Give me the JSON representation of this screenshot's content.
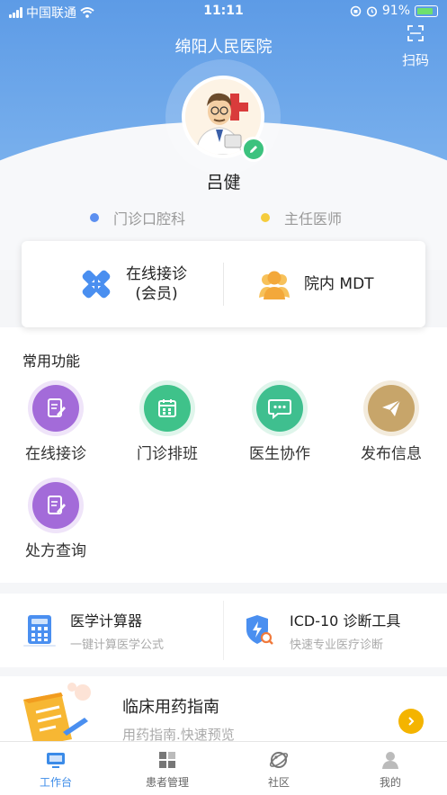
{
  "status_bar": {
    "carrier": "中国联通",
    "time": "11:11",
    "battery": "91%"
  },
  "header": {
    "title": "绵阳人民医院",
    "scan_label": "扫码"
  },
  "profile": {
    "name": "吕健",
    "department": "门诊口腔科",
    "title": "主任医师",
    "department_dot_color": "#5b8ff0",
    "title_dot_color": "#f5cc3c"
  },
  "main_card": {
    "consult_line1": "在线接诊",
    "consult_line2": "(会员)",
    "mdt_label": "院内 MDT"
  },
  "functions": {
    "title": "常用功能",
    "items": [
      {
        "label": "在线接诊",
        "icon": "clipboard-pen-icon",
        "color": "#a36bd9"
      },
      {
        "label": "门诊排班",
        "icon": "calendar-icon",
        "color": "#3fc28a"
      },
      {
        "label": "医生协作",
        "icon": "chat-icon",
        "color": "#3fbf8f"
      },
      {
        "label": "发布信息",
        "icon": "paper-plane-icon",
        "color": "#c7a56a"
      },
      {
        "label": "处方查询",
        "icon": "prescription-icon",
        "color": "#a36bd9"
      }
    ]
  },
  "tools": {
    "calculator_title": "医学计算器",
    "calculator_sub": "一键计算医学公式",
    "icd_title": "ICD-10 诊断工具",
    "icd_sub": "快速专业医疗诊断"
  },
  "guide": {
    "title": "临床用药指南",
    "subtitle": "用药指南.快速预览"
  },
  "tabbar": {
    "tabs": [
      {
        "label": "工作台"
      },
      {
        "label": "患者管理"
      },
      {
        "label": "社区"
      },
      {
        "label": "我的"
      }
    ],
    "active_color": "#3b8be8"
  }
}
